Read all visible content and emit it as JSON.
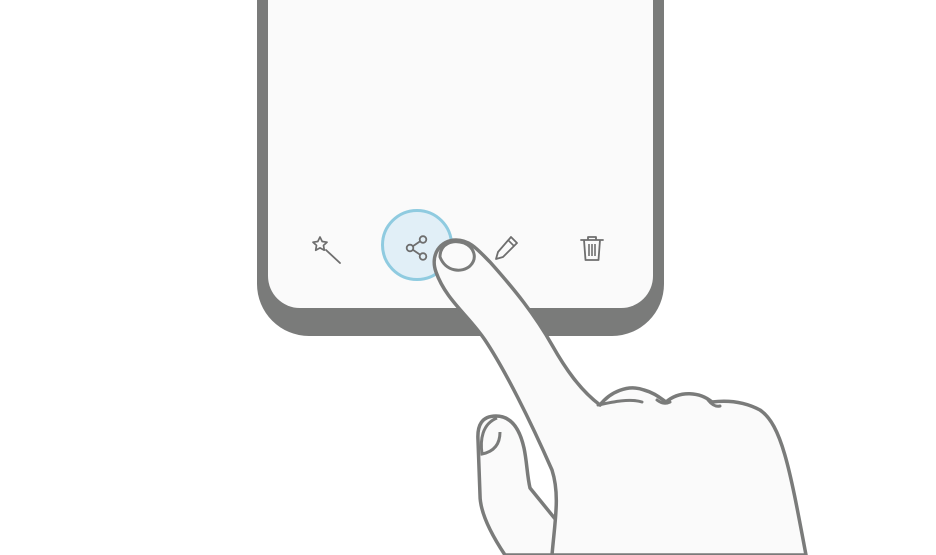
{
  "phone": {
    "frame_color": "#7a7b7a",
    "screen_color": "#fafafa"
  },
  "toolbar": {
    "buttons": [
      {
        "icon": "magic-wand-icon",
        "action": "edit-effects"
      },
      {
        "icon": "share-icon",
        "action": "share",
        "highlighted": true
      },
      {
        "icon": "pencil-icon",
        "action": "edit"
      },
      {
        "icon": "trash-icon",
        "action": "delete"
      }
    ],
    "highlight_color": "#8fcbe0",
    "highlight_fill": "#e1eff7",
    "icon_color": "#6e6e6e"
  },
  "gesture": {
    "type": "tap",
    "target": "share-button"
  }
}
